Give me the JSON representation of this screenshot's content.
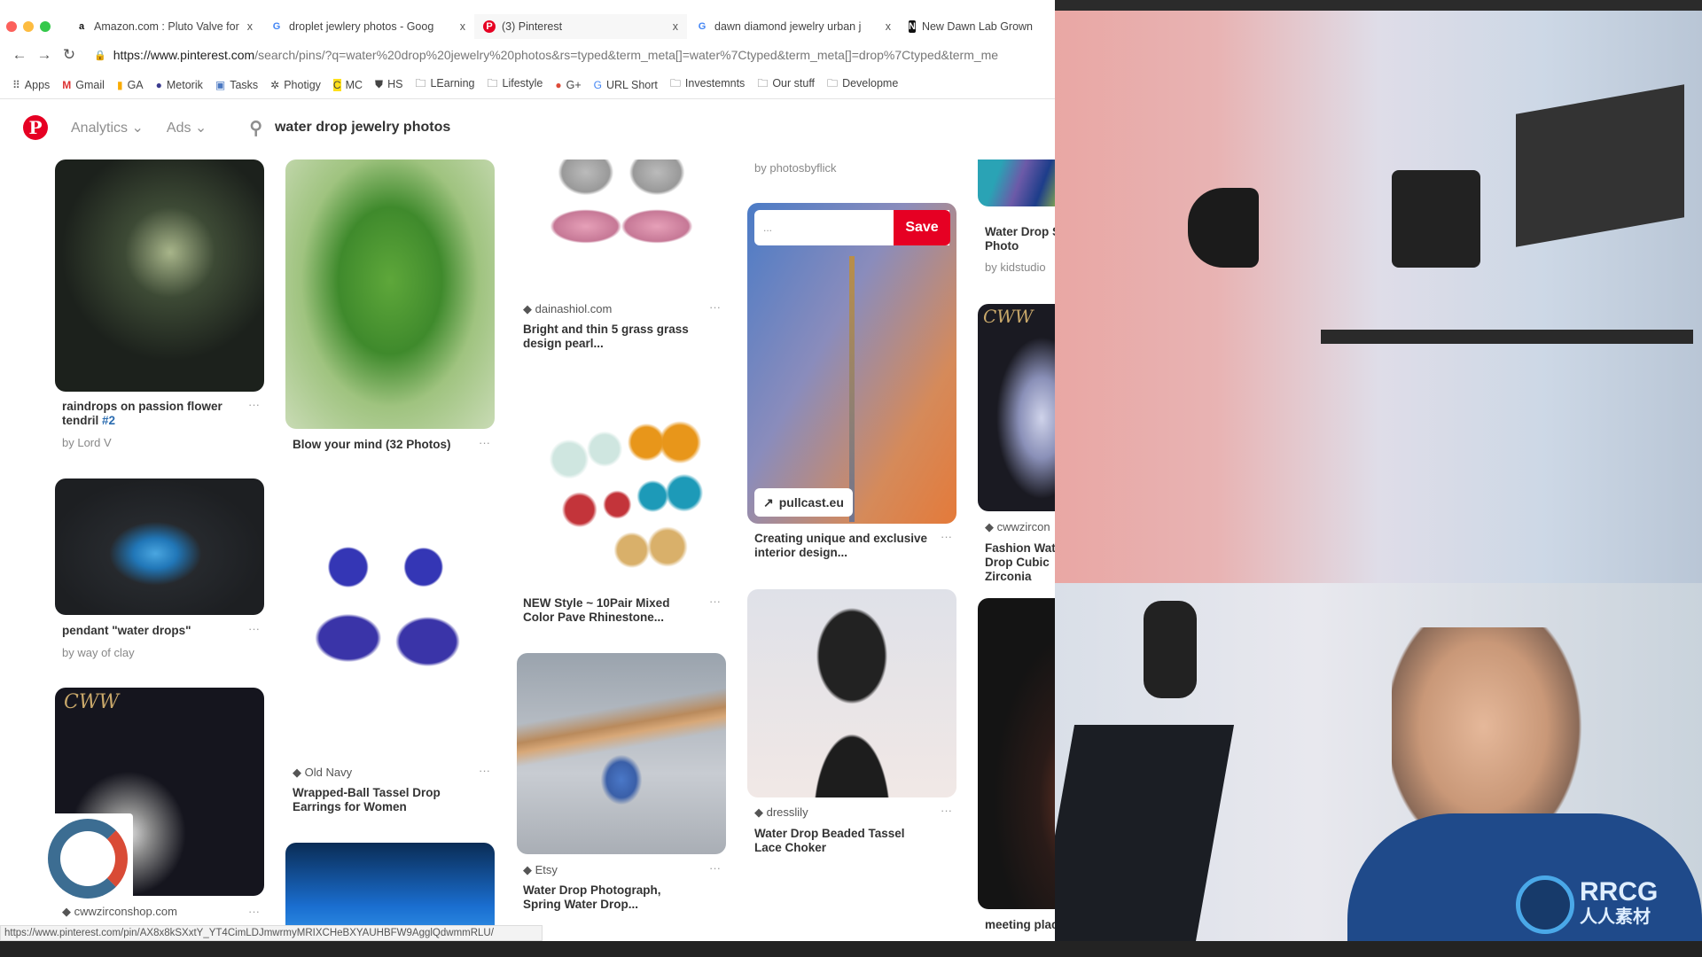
{
  "browser": {
    "tabs": [
      {
        "label": "Amazon.com : Pluto Valve for",
        "icon": "amazon-icon"
      },
      {
        "label": "droplet jewlery photos - Goog",
        "icon": "google-icon"
      },
      {
        "label": "(3) Pinterest",
        "icon": "pinterest-icon"
      },
      {
        "label": "dawn diamond jewelry urban j",
        "icon": "google-icon"
      },
      {
        "label": "New Dawn Lab Grown",
        "icon": "newdawn-icon"
      }
    ],
    "close": "x",
    "url_host": "https://www.pinterest.com",
    "url_path": "/search/pins/?q=water%20drop%20jewelry%20photos&rs=typed&term_meta[]=water%7Ctyped&term_meta[]=drop%7Ctyped&term_me",
    "bookmarks": [
      "Apps",
      "Gmail",
      "GA",
      "Metorik",
      "Tasks",
      "Photigy",
      "MC",
      "HS",
      "LEarning",
      "Lifestyle",
      "G+",
      "URL Short",
      "Investemnts",
      "Our stuff",
      "Developme"
    ],
    "status_url": "https://www.pinterest.com/pin/AX8x8kSXxtY_YT4CimLDJmwrmyMRIXCHeBXYAUHBFW9AgglQdwmmRLU/"
  },
  "pinterest": {
    "logo": "P",
    "menu": [
      "Analytics",
      "Ads"
    ],
    "search_query": "water drop jewelry photos",
    "accent": "#e60023",
    "pins": {
      "c1": [
        {
          "title": "raindrops on passion flower tendril",
          "tag": "#2",
          "by": "by Lord V"
        },
        {
          "title": "pendant \"water drops\"",
          "by": "by way of clay"
        },
        {
          "source": "cwwzirconshop.com"
        }
      ],
      "c2": [
        {
          "title": "Blow your mind (32 Photos)"
        },
        {
          "source": "Old Navy",
          "title": "Wrapped-Ball Tassel Drop Earrings for Women"
        }
      ],
      "c3": [
        {
          "source": "dainashiol.com",
          "title": "Bright and thin 5 grass grass design pearl..."
        },
        {
          "title": "NEW Style ~ 10Pair Mixed Color Pave Rhinestone..."
        },
        {
          "source": "Etsy",
          "title": "Water Drop Photograph, Spring Water Drop..."
        }
      ],
      "c4": [
        {
          "by": "by photosbyflick"
        },
        {
          "board": "...",
          "save": "Save",
          "link": "pullcast.eu",
          "title": "Creating unique and exclusive interior design..."
        },
        {
          "source": "dresslily",
          "title": "Water Drop Beaded Tassel Lace Choker"
        }
      ],
      "c5": [
        {
          "title": "Water Drop Stock Photo",
          "by": "by kidstudio"
        },
        {
          "source": "cwwzircon",
          "title": "Fashion Water Drop Cubic Zirconia",
          "brand": "CWW"
        },
        {
          "title": "meeting place"
        }
      ]
    },
    "more": "···"
  },
  "watermark": {
    "logo": "RRCG",
    "sub": "人人素材"
  }
}
